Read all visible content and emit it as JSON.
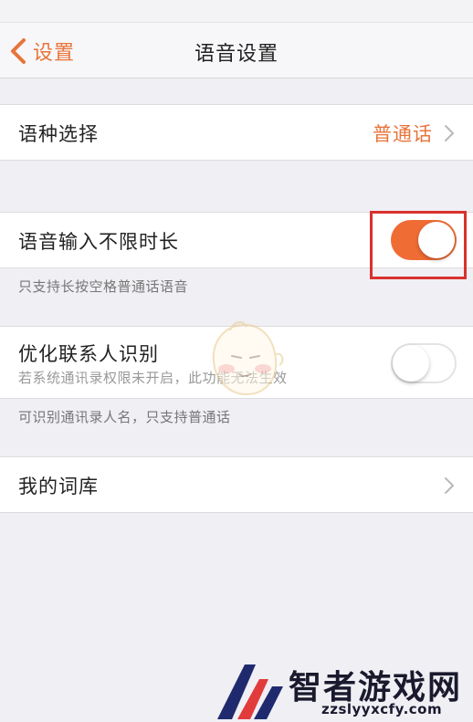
{
  "nav": {
    "back_label": "设置",
    "title": "语音设置"
  },
  "language": {
    "label": "语种选择",
    "value": "普通话"
  },
  "unlimited_input": {
    "label": "语音输入不限时长",
    "enabled": true,
    "footnote": "只支持长按空格普通话语音"
  },
  "contacts": {
    "label": "优化联系人识别",
    "sublabel": "若系统通讯录权限未开启，此功能无法生效",
    "enabled": false,
    "footnote": "可识别通讯录人名，只支持普通话"
  },
  "dictionary": {
    "label": "我的词库"
  },
  "watermark": {
    "brand_name": "智者游戏网",
    "url": "zzslyyxcfy.com"
  },
  "colors": {
    "accent": "#e8743a",
    "toggle_on": "#ef6c35",
    "highlight": "#d9312f",
    "background": "#efeff4"
  },
  "icons": {
    "back": "chevron-left-icon",
    "disclosure": "chevron-right-icon"
  }
}
